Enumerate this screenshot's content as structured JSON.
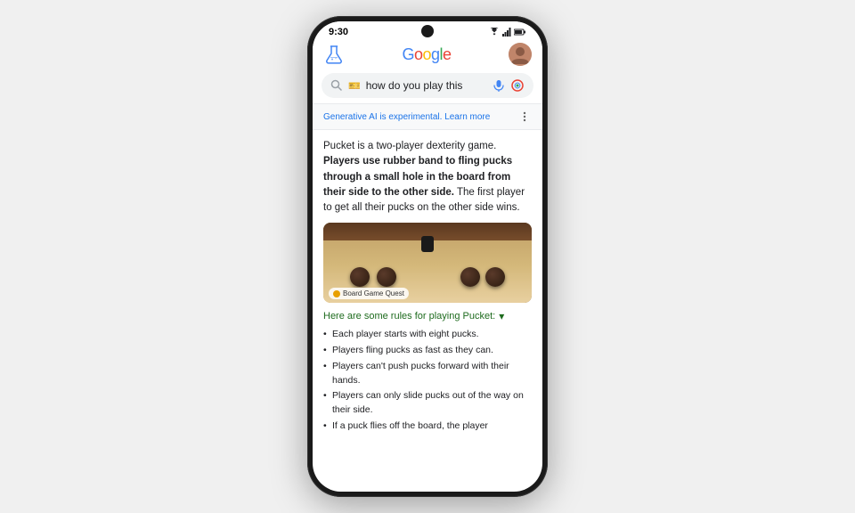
{
  "phone": {
    "status_bar": {
      "time": "9:30"
    },
    "top_bar": {
      "flask_label": "flask",
      "google_logo": "Google",
      "avatar_label": "user avatar"
    },
    "search": {
      "placeholder": "how do you play this",
      "icon_search": "search",
      "icon_voice": "microphone",
      "icon_lens": "google lens"
    },
    "ai_banner": {
      "text": "Generative AI is experimental.",
      "learn_more": "Learn more",
      "more_options": "more options"
    },
    "summary": {
      "paragraph1": "Pucket is a two-player dexterity game.",
      "bold_text": "Players use rubber band to fling pucks through a small hole in the board from their side to the other side.",
      "paragraph2": " The first player to get all their pucks on the other side wins."
    },
    "image": {
      "caption": "Board Game Quest"
    },
    "rules": {
      "header": "Here are some rules for playing Pucket:",
      "items": [
        "Each player starts with eight pucks.",
        "Players fling pucks as fast as they can.",
        "Players can't push pucks forward with their hands.",
        "Players can only slide pucks out of the way on their side.",
        "If a puck flies off the board, the player"
      ]
    }
  }
}
